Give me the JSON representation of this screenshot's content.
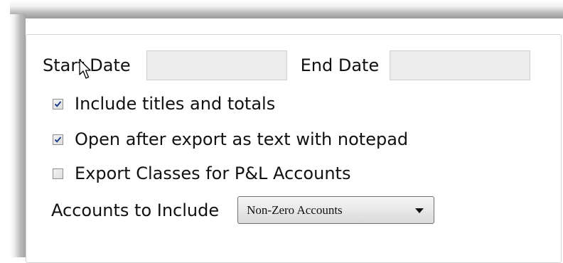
{
  "form": {
    "start_date_label": "Start Date",
    "start_date_value": "",
    "end_date_label": "End Date",
    "end_date_value": "",
    "options": [
      {
        "label": "Include titles and totals",
        "checked": true
      },
      {
        "label": "Open after export as text with notepad",
        "checked": true
      },
      {
        "label": "Export Classes for P&L Accounts",
        "checked": false
      }
    ],
    "accounts_label": "Accounts to Include",
    "accounts_selected": "Non-Zero Accounts"
  },
  "colors": {
    "checkmark": "#1f3f8f",
    "field_bg": "#ececec"
  },
  "icons": {
    "cursor": "mouse-pointer-icon",
    "checkmark": "checkmark-icon",
    "dropdown": "chevron-down-icon"
  }
}
